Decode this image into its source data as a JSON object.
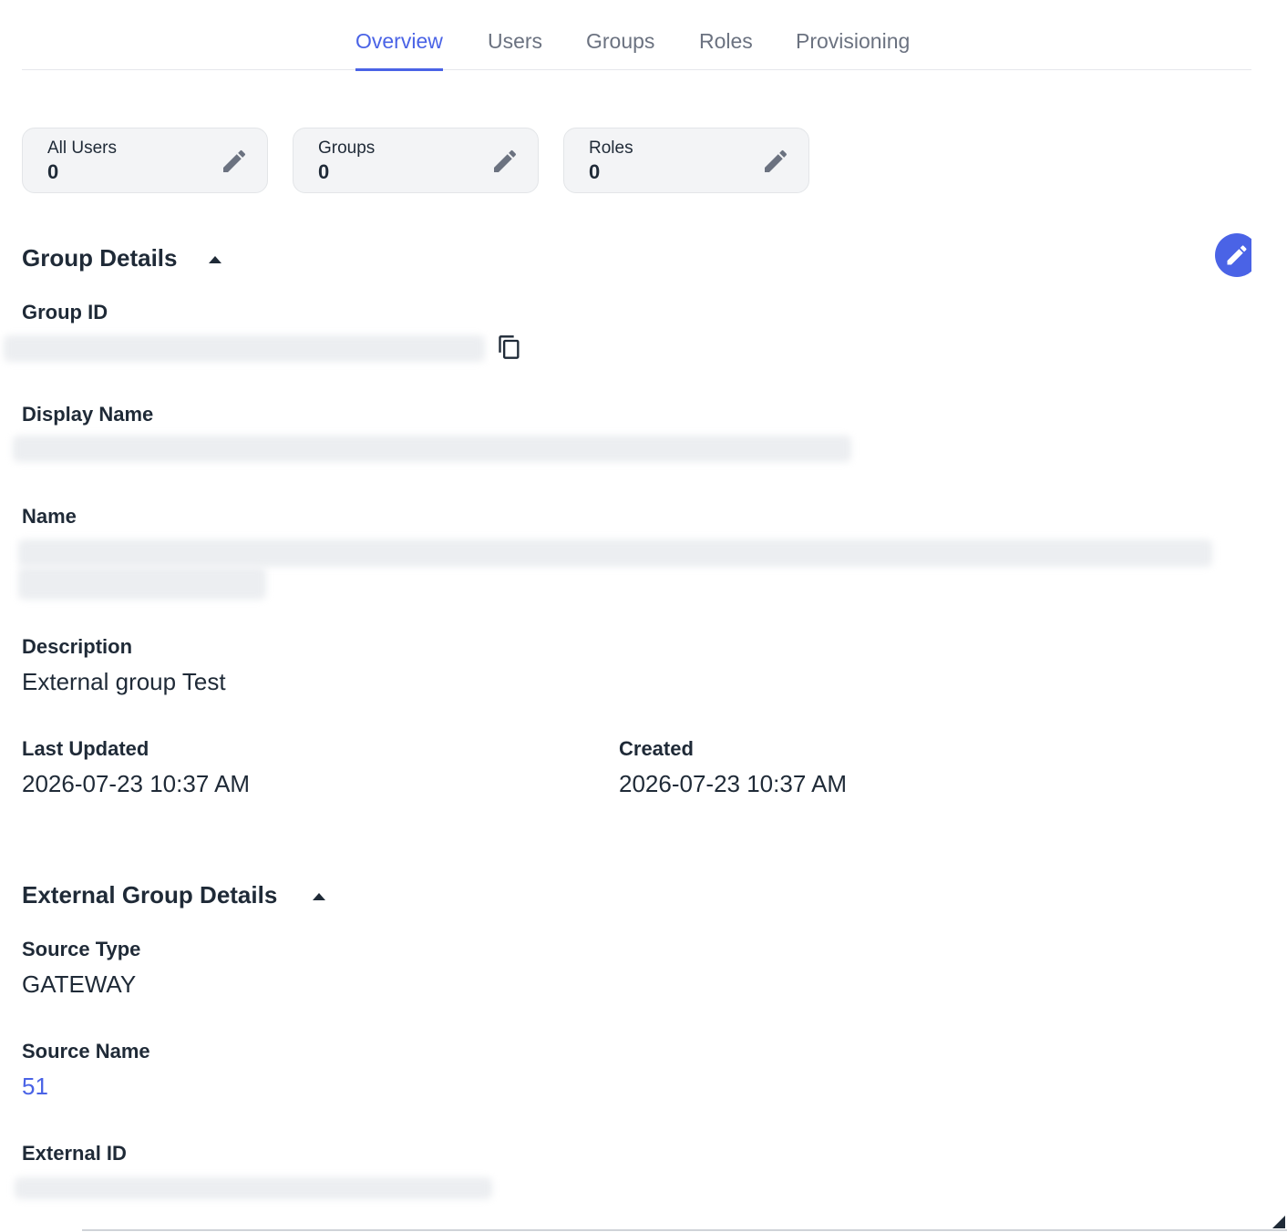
{
  "tabs": [
    {
      "label": "Overview",
      "active": true
    },
    {
      "label": "Users",
      "active": false
    },
    {
      "label": "Groups",
      "active": false
    },
    {
      "label": "Roles",
      "active": false
    },
    {
      "label": "Provisioning",
      "active": false
    }
  ],
  "cards": [
    {
      "label": "All Users",
      "count": "0",
      "icon": "pencil-icon"
    },
    {
      "label": "Groups",
      "count": "0",
      "icon": "pencil-icon"
    },
    {
      "label": "Roles",
      "count": "0",
      "icon": "pencil-icon"
    }
  ],
  "group_details": {
    "title": "Group Details",
    "group_id": {
      "label": "Group ID",
      "value": ""
    },
    "display_name": {
      "label": "Display Name",
      "value": ""
    },
    "name": {
      "label": "Name",
      "value": ""
    },
    "description": {
      "label": "Description",
      "value": "External group Test"
    },
    "last_updated": {
      "label": "Last Updated",
      "value": "2026-07-23 10:37 AM"
    },
    "created": {
      "label": "Created",
      "value": "2026-07-23 10:37 AM"
    }
  },
  "external_group_details": {
    "title": "External Group Details",
    "source_type": {
      "label": "Source Type",
      "value": "GATEWAY"
    },
    "source_name": {
      "label": "Source Name",
      "value": "51"
    },
    "external_id": {
      "label": "External ID",
      "value": ""
    }
  },
  "colors": {
    "accent": "#4a63e6",
    "text": "#1f2a37",
    "muted": "#6b7280",
    "card_bg": "#f3f4f6"
  }
}
